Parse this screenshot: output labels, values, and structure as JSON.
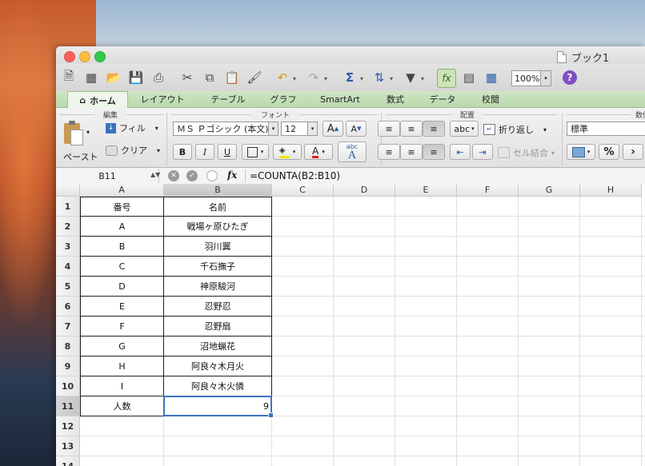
{
  "window": {
    "title": "ブック1"
  },
  "toolbar": {
    "zoom": "100%",
    "help_label": "?"
  },
  "tabs": [
    {
      "label": "ホーム",
      "active": true
    },
    {
      "label": "レイアウト"
    },
    {
      "label": "テーブル"
    },
    {
      "label": "グラフ"
    },
    {
      "label": "SmartArt"
    },
    {
      "label": "数式"
    },
    {
      "label": "データ"
    },
    {
      "label": "校閲"
    }
  ],
  "ribbon": {
    "groups": {
      "edit": "編集",
      "font": "フォント",
      "align": "配置",
      "number": "数値"
    },
    "paste_label": "ペースト",
    "fill_label": "フィル",
    "clear_label": "クリア",
    "font_name": "ＭＳ Ｐゴシック (本文)",
    "font_size": "12",
    "grow_label": "A",
    "shrink_label": "A",
    "bold": "B",
    "italic": "I",
    "underline": "U",
    "font_color_label": "A",
    "abc_label": "abc",
    "abc2_label": "abc",
    "abc2_letter": "A",
    "wrap_label": "折り返し",
    "merge_label": "セル結合",
    "number_format": "標準",
    "percent": "%",
    "comma": "›"
  },
  "formula_bar": {
    "cell_ref": "B11",
    "fx": "fx",
    "formula": "=COUNTA(B2:B10)"
  },
  "sheet": {
    "columns": [
      "A",
      "B",
      "C",
      "D",
      "E",
      "F",
      "G",
      "H"
    ],
    "rows": [
      "1",
      "2",
      "3",
      "4",
      "5",
      "6",
      "7",
      "8",
      "9",
      "10",
      "11",
      "12",
      "13",
      "14"
    ],
    "selected_cell": "B11",
    "table": [
      [
        "番号",
        "名前"
      ],
      [
        "A",
        "戦場ヶ原ひたぎ"
      ],
      [
        "B",
        "羽川翼"
      ],
      [
        "C",
        "千石撫子"
      ],
      [
        "D",
        "神原駿河"
      ],
      [
        "E",
        "忍野忍"
      ],
      [
        "F",
        "忍野扇"
      ],
      [
        "G",
        "沼地蝋花"
      ],
      [
        "H",
        "阿良々木月火"
      ],
      [
        "I",
        "阿良々木火憐"
      ],
      [
        "人数",
        "9"
      ]
    ]
  },
  "colors": {
    "selection": "#3e71c1",
    "tab_bar": "#b9d9ad",
    "help": "#7d4fc4"
  }
}
